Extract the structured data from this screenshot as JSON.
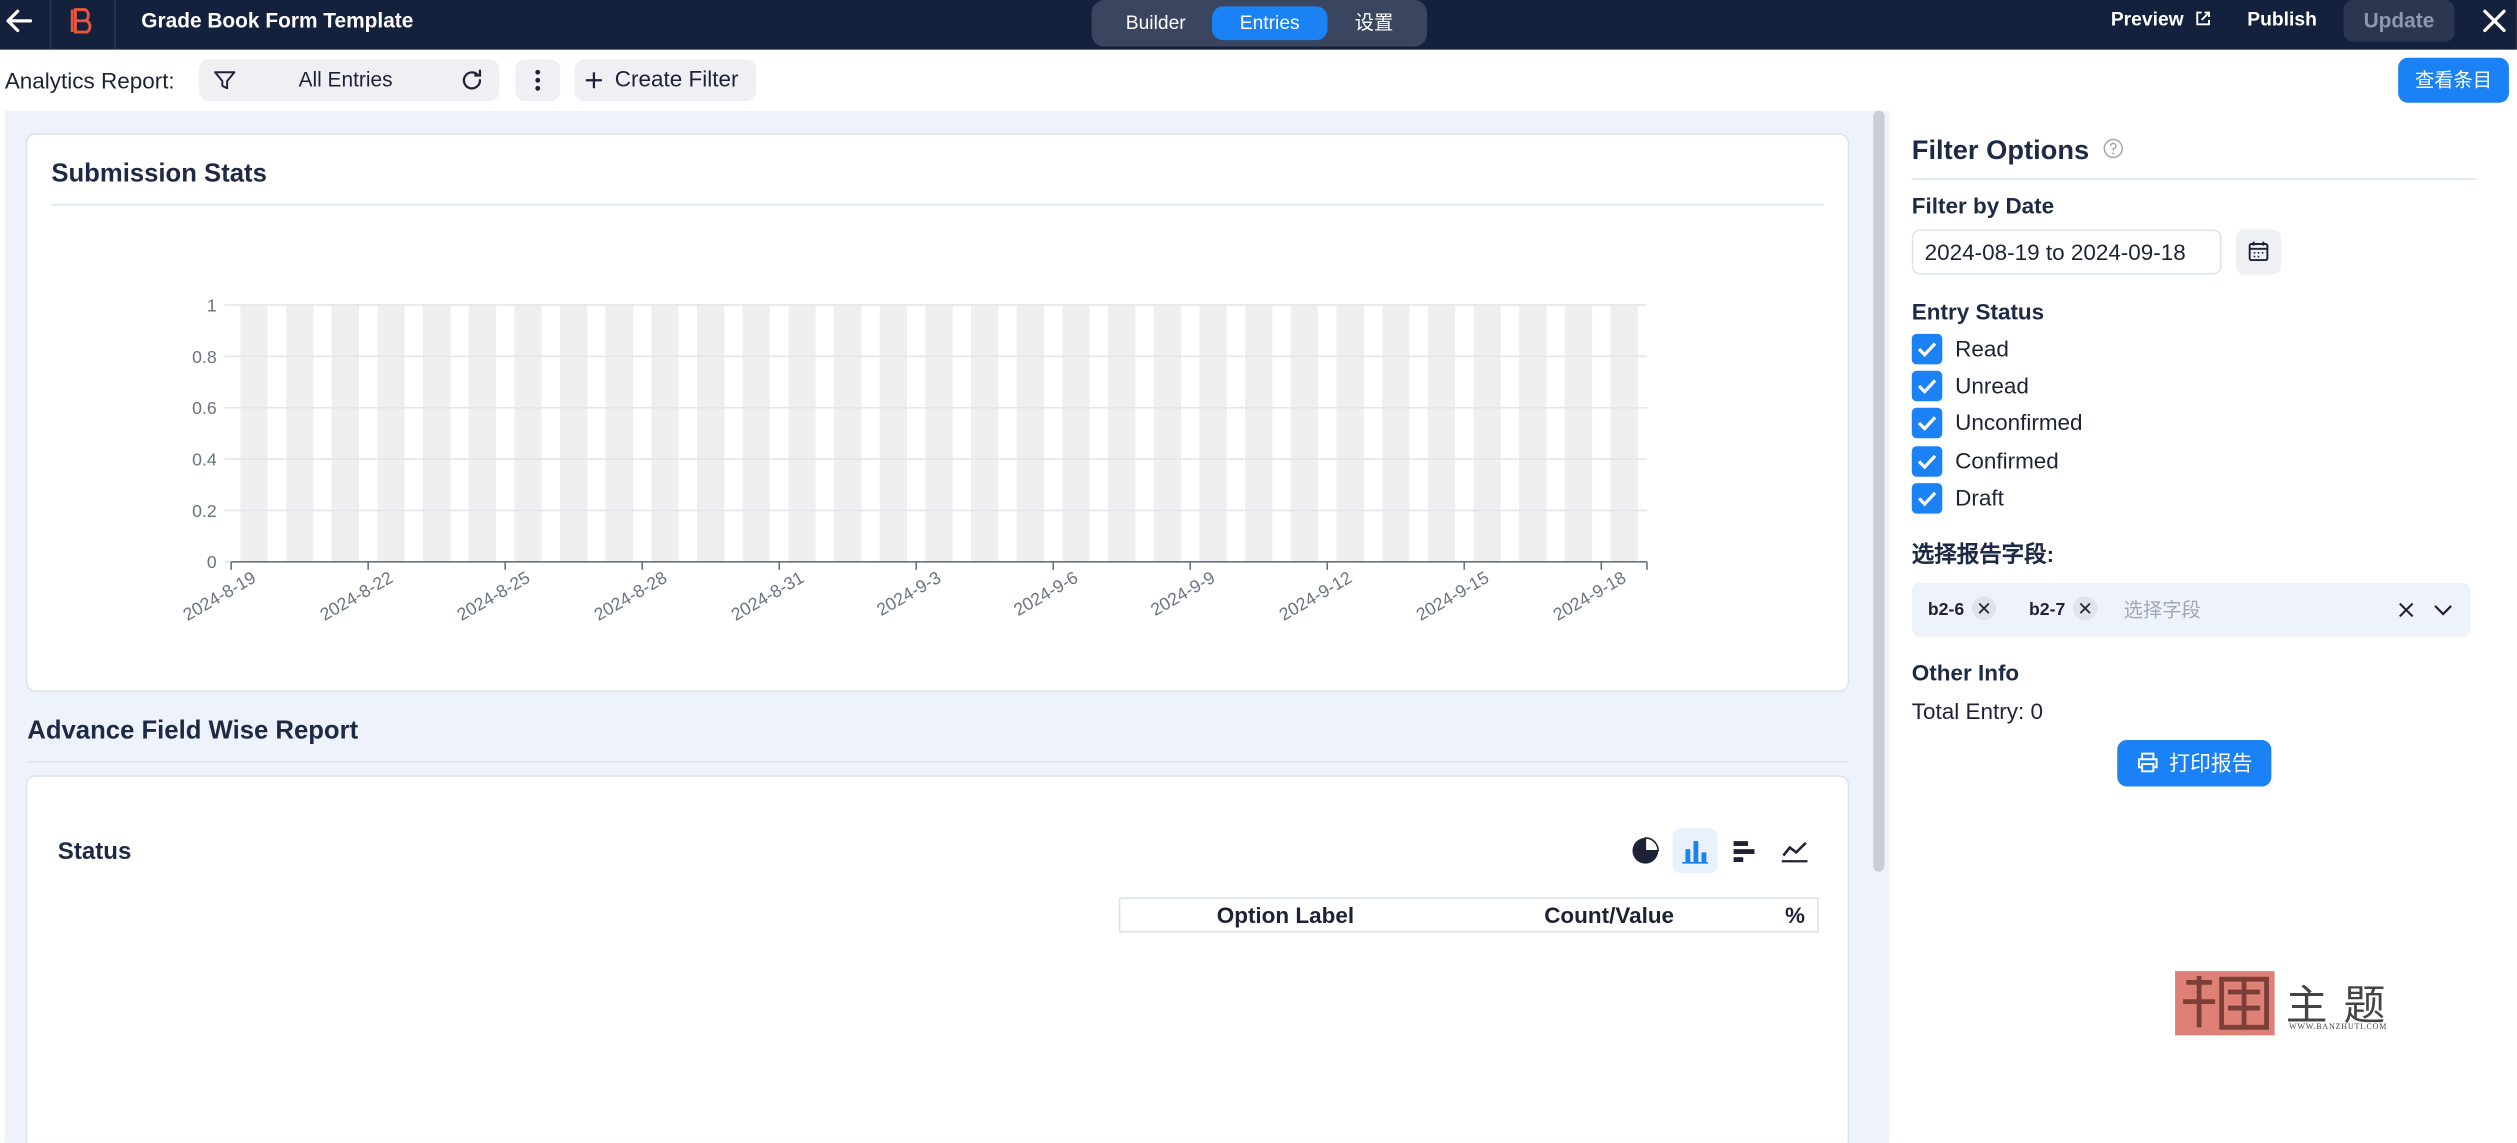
{
  "header": {
    "title": "Grade Book Form Template",
    "tabs": [
      {
        "label": "Builder",
        "active": false
      },
      {
        "label": "Entries",
        "active": true
      },
      {
        "label": "设置",
        "active": false
      }
    ],
    "preview_label": "Preview",
    "publish_label": "Publish",
    "update_label": "Update"
  },
  "toolbar": {
    "analytics_label": "Analytics Report:",
    "filter_value": "All Entries",
    "create_filter_label": "Create Filter",
    "view_entries_label": "查看条目"
  },
  "submission_stats": {
    "title": "Submission Stats"
  },
  "chart_data": {
    "type": "bar",
    "title": "Submission Stats",
    "ylim": [
      0,
      1
    ],
    "y_ticks": [
      "0",
      "0.2",
      "0.4",
      "0.6",
      "0.8",
      "1"
    ],
    "x_tick_labels": [
      "2024-8-19",
      "2024-8-22",
      "2024-8-25",
      "2024-8-28",
      "2024-8-31",
      "2024-9-3",
      "2024-9-6",
      "2024-9-9",
      "2024-9-12",
      "2024-9-15",
      "2024-9-18"
    ],
    "categories": [
      "2024-8-19",
      "2024-8-20",
      "2024-8-21",
      "2024-8-22",
      "2024-8-23",
      "2024-8-24",
      "2024-8-25",
      "2024-8-26",
      "2024-8-27",
      "2024-8-28",
      "2024-8-29",
      "2024-8-30",
      "2024-8-31",
      "2024-9-1",
      "2024-9-2",
      "2024-9-3",
      "2024-9-4",
      "2024-9-5",
      "2024-9-6",
      "2024-9-7",
      "2024-9-8",
      "2024-9-9",
      "2024-9-10",
      "2024-9-11",
      "2024-9-12",
      "2024-9-13",
      "2024-9-14",
      "2024-9-15",
      "2024-9-16",
      "2024-9-17",
      "2024-9-18"
    ],
    "values": [
      0,
      0,
      0,
      0,
      0,
      0,
      0,
      0,
      0,
      0,
      0,
      0,
      0,
      0,
      0,
      0,
      0,
      0,
      0,
      0,
      0,
      0,
      0,
      0,
      0,
      0,
      0,
      0,
      0,
      0,
      0
    ],
    "grid": true,
    "background_bar_color": "#efefef"
  },
  "advance_report": {
    "title": "Advance Field Wise Report",
    "field_title": "Status",
    "chart_types": [
      "pie-chart-icon",
      "bar-chart-icon",
      "horizontal-bar-icon",
      "line-chart-icon"
    ],
    "active_chart_type": "bar-chart-icon",
    "table_headers": [
      "Option Label",
      "Count/Value",
      "%"
    ]
  },
  "filter_options": {
    "title": "Filter Options",
    "date_heading": "Filter by Date",
    "date_range": "2024-08-19 to 2024-09-18",
    "status_heading": "Entry Status",
    "statuses": [
      {
        "label": "Read",
        "checked": true
      },
      {
        "label": "Unread",
        "checked": true
      },
      {
        "label": "Unconfirmed",
        "checked": true
      },
      {
        "label": "Confirmed",
        "checked": true
      },
      {
        "label": "Draft",
        "checked": true
      }
    ],
    "fields_heading": "选择报告字段:",
    "selected_fields": [
      "b2-6",
      "b2-7"
    ],
    "fields_placeholder": "选择字段",
    "other_heading": "Other Info",
    "total_entry": "Total Entry: 0",
    "print_label": "打印报告"
  },
  "watermark": {
    "text": "主题",
    "url": "WWW.BANZHUTI.COM"
  },
  "colors": {
    "accent": "#1a82f5",
    "topbar": "#14213d",
    "panel_bg": "#eef3fb"
  }
}
